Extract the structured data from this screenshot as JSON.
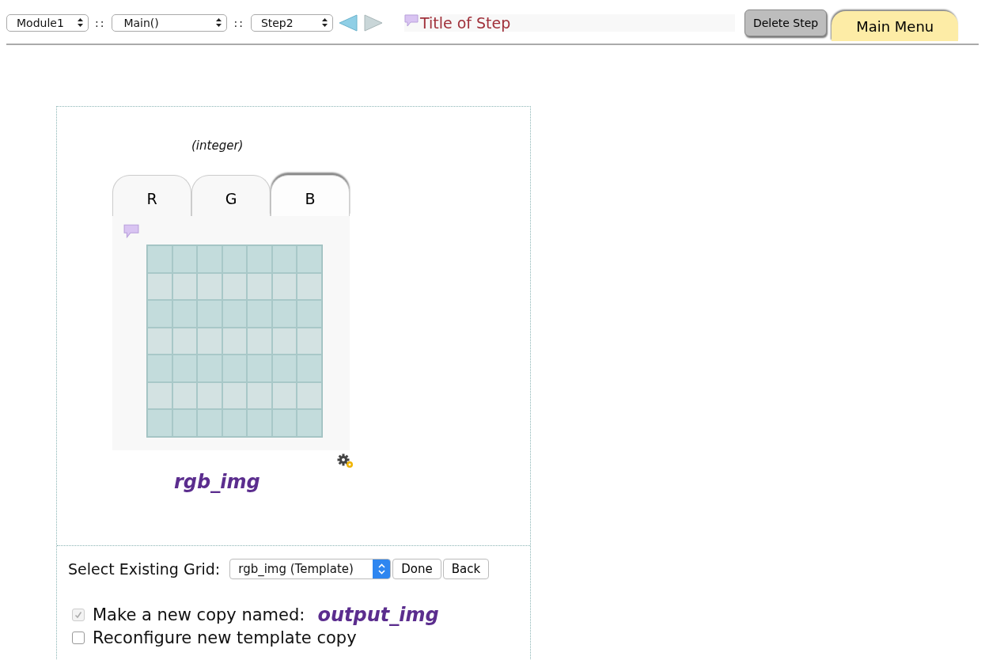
{
  "toolbar": {
    "selects": [
      {
        "value": "Module1",
        "kind": "short"
      },
      {
        "value": "Main()",
        "kind": "wide"
      },
      {
        "value": "Step2",
        "kind": "short"
      }
    ],
    "separator": "::",
    "arrows": [
      {
        "kind": "back",
        "disabled": false
      },
      {
        "kind": "forward",
        "disabled": true
      }
    ],
    "step_title": "Title of Step",
    "delete_button": "Delete Step",
    "main_menu": "Main Menu"
  },
  "grid_panel": {
    "type_label": "(integer)",
    "tabs": [
      {
        "label": "R",
        "selected": false
      },
      {
        "label": "G",
        "selected": false
      },
      {
        "label": "B",
        "selected": true
      }
    ],
    "grid_name": "rgb_img"
  },
  "options": {
    "select_label": "Select Existing Grid:",
    "select_value": "rgb_img (Template)",
    "buttons": [
      "Done",
      "Back"
    ],
    "checkboxes": [
      {
        "label": "Make a new copy named:",
        "name": "output_img",
        "checked": true,
        "disabled": true
      },
      {
        "label": "Reconfigure new template copy",
        "checked": false,
        "disabled": false
      }
    ]
  }
}
